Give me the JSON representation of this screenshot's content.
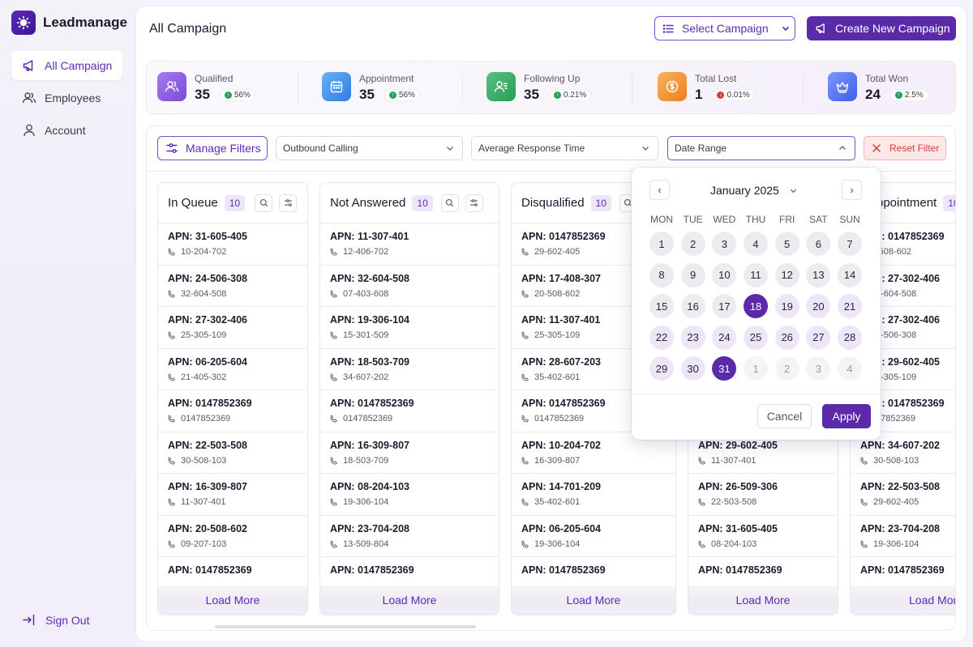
{
  "app": {
    "name": "Leadmanage"
  },
  "sidebar": {
    "items": [
      {
        "label": "All Campaign",
        "icon": "megaphone-icon",
        "active": true
      },
      {
        "label": "Employees",
        "icon": "users-icon"
      },
      {
        "label": "Account",
        "icon": "user-icon"
      }
    ],
    "signout_label": "Sign Out"
  },
  "header": {
    "title": "All Campaign",
    "select_campaign_label": "Select Campaign",
    "create_campaign_label": "Create New Campaign"
  },
  "stats": [
    {
      "label": "Qualified",
      "value": "35",
      "change": "56%",
      "trend": "up",
      "icon": "users-icon",
      "color": "#8b5cf6"
    },
    {
      "label": "Appointment",
      "value": "35",
      "change": "56%",
      "trend": "up",
      "icon": "calendar-icon",
      "color": "#3b82f6"
    },
    {
      "label": "Following Up",
      "value": "35",
      "change": "0.21%",
      "trend": "up",
      "icon": "contact-icon",
      "color": "#22a35a"
    },
    {
      "label": "Total Lost",
      "value": "1",
      "change": "0.01%",
      "trend": "down",
      "icon": "dollar-icon",
      "color": "#f08a24"
    },
    {
      "label": "Total Won",
      "value": "24",
      "change": "2.5%",
      "trend": "up",
      "icon": "crown-icon",
      "color": "#4f6df5"
    }
  ],
  "filters": {
    "manage_label": "Manage Filters",
    "dropdowns": [
      "Outbound Calling",
      "Average Response Time",
      "Date Range"
    ],
    "reset_label": "Reset Filter"
  },
  "columns": [
    {
      "title": "In Queue",
      "count": "10",
      "load_more": "Load More",
      "cards": [
        {
          "apn": "APN: 31-605-405",
          "phone": "10-204-702"
        },
        {
          "apn": "APN: 24-506-308",
          "phone": "32-604-508"
        },
        {
          "apn": "APN: 27-302-406",
          "phone": "25-305-109"
        },
        {
          "apn": "APN: 06-205-604",
          "phone": "21-405-302"
        },
        {
          "apn": "APN: 0147852369",
          "phone": "0147852369"
        },
        {
          "apn": "APN: 22-503-508",
          "phone": "30-508-103"
        },
        {
          "apn": "APN: 16-309-807",
          "phone": "11-307-401"
        },
        {
          "apn": "APN: 20-508-602",
          "phone": "09-207-103"
        },
        {
          "apn": "APN: 0147852369",
          "phone": ""
        }
      ]
    },
    {
      "title": "Not Answered",
      "count": "10",
      "load_more": "Load More",
      "cards": [
        {
          "apn": "APN: 11-307-401",
          "phone": "12-406-702"
        },
        {
          "apn": "APN: 32-604-508",
          "phone": "07-403-608"
        },
        {
          "apn": "APN: 19-306-104",
          "phone": "15-301-509"
        },
        {
          "apn": "APN: 18-503-709",
          "phone": "34-607-202"
        },
        {
          "apn": "APN: 0147852369",
          "phone": "0147852369"
        },
        {
          "apn": "APN: 16-309-807",
          "phone": "18-503-709"
        },
        {
          "apn": "APN: 08-204-103",
          "phone": "19-306-104"
        },
        {
          "apn": "APN: 23-704-208",
          "phone": "13-509-804"
        },
        {
          "apn": "APN: 0147852369",
          "phone": ""
        }
      ]
    },
    {
      "title": "Disqualified",
      "count": "10",
      "load_more": "Load More",
      "cards": [
        {
          "apn": "APN: 0147852369",
          "phone": "29-602-405"
        },
        {
          "apn": "APN: 17-408-307",
          "phone": "20-508-602"
        },
        {
          "apn": "APN: 11-307-401",
          "phone": "25-305-109"
        },
        {
          "apn": "APN: 28-607-203",
          "phone": "35-402-601"
        },
        {
          "apn": "APN: 0147852369",
          "phone": "0147852369"
        },
        {
          "apn": "APN: 10-204-702",
          "phone": "16-309-807"
        },
        {
          "apn": "APN: 14-701-209",
          "phone": "35-402-601"
        },
        {
          "apn": "APN: 06-205-604",
          "phone": "19-306-104"
        },
        {
          "apn": "APN: 0147852369",
          "phone": ""
        }
      ]
    },
    {
      "title": "",
      "count": "",
      "load_more": "Load More",
      "cards": [
        {
          "apn": "",
          "phone": ""
        },
        {
          "apn": "",
          "phone": ""
        },
        {
          "apn": "",
          "phone": ""
        },
        {
          "apn": "",
          "phone": ""
        },
        {
          "apn": "",
          "phone": ""
        },
        {
          "apn": "APN: 29-602-405",
          "phone": "11-307-401"
        },
        {
          "apn": "APN: 26-509-306",
          "phone": "22-503-508"
        },
        {
          "apn": "APN: 31-605-405",
          "phone": "08-204-103"
        },
        {
          "apn": "APN: 0147852369",
          "phone": ""
        }
      ]
    },
    {
      "title": "ppointment",
      "count": "10",
      "load_more": "Load Mor",
      "cards": [
        {
          "apn": "APN: 0147852369",
          "phone": "-508-602"
        },
        {
          "apn": "APN: 27-302-406",
          "phone": "2-604-508"
        },
        {
          "apn": "APN: 27-302-406",
          "phone": "4-506-308"
        },
        {
          "apn": "APN: 29-602-405",
          "phone": "5-305-109"
        },
        {
          "apn": "APN: 0147852369",
          "phone": "47852369"
        },
        {
          "apn": "APN: 34-607-202",
          "phone": "30-508-103"
        },
        {
          "apn": "APN: 22-503-508",
          "phone": "29-602-405"
        },
        {
          "apn": "APN: 23-704-208",
          "phone": "19-306-104"
        },
        {
          "apn": "APN: 0147852369",
          "phone": ""
        }
      ]
    }
  ],
  "calendar": {
    "month_label": "January 2025",
    "weekdays": [
      "MON",
      "TUE",
      "WED",
      "THU",
      "FRI",
      "SAT",
      "SUN"
    ],
    "days": [
      [
        "1",
        "2",
        "3",
        "4",
        "5",
        "6",
        "7"
      ],
      [
        "8",
        "9",
        "10",
        "11",
        "12",
        "13",
        "14"
      ],
      [
        "15",
        "16",
        "17",
        "18",
        "19",
        "20",
        "21"
      ],
      [
        "22",
        "23",
        "24",
        "25",
        "26",
        "27",
        "28"
      ],
      [
        "29",
        "30",
        "31",
        "1",
        "2",
        "3",
        "4"
      ]
    ],
    "range_start": "18",
    "range_end": "31",
    "cancel_label": "Cancel",
    "apply_label": "Apply"
  }
}
